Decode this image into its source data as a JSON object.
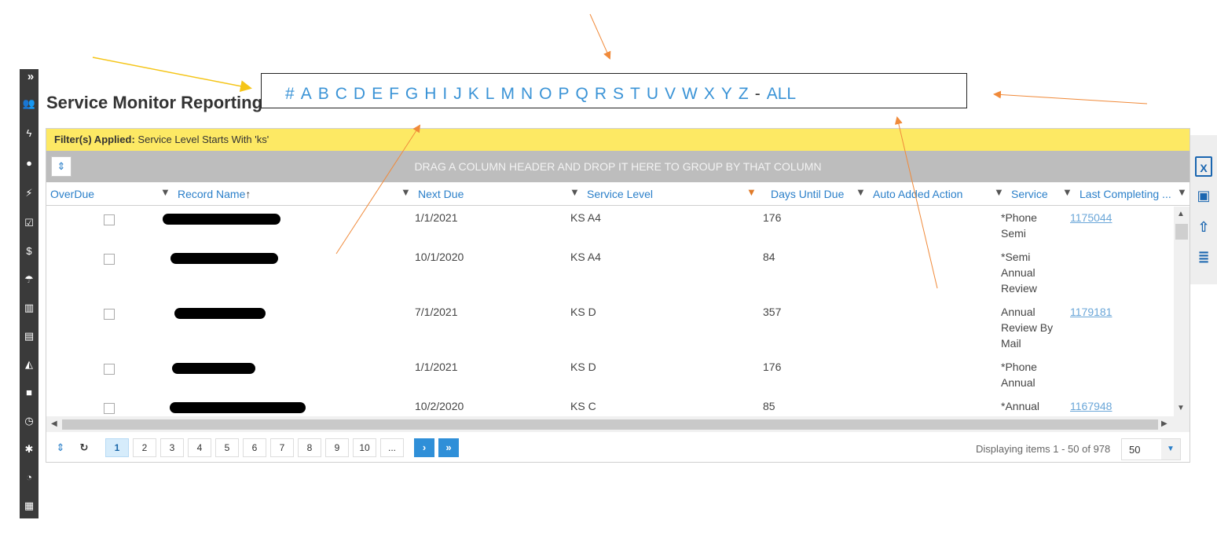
{
  "page": {
    "title": "Service Monitor Reporting"
  },
  "nav": {
    "expand_glyph": "»"
  },
  "alpha_filter": {
    "letters": [
      "#",
      "A",
      "B",
      "C",
      "D",
      "E",
      "F",
      "G",
      "H",
      "I",
      "J",
      "K",
      "L",
      "M",
      "N",
      "O",
      "P",
      "Q",
      "R",
      "S",
      "T",
      "U",
      "V",
      "W",
      "X",
      "Y",
      "Z"
    ],
    "separator": "-",
    "all_label": "ALL"
  },
  "filter_bar": {
    "label": "Filter(s) Applied:",
    "text": "Service Level Starts With 'ks'"
  },
  "group_bar": {
    "text": "DRAG A COLUMN HEADER AND DROP IT HERE TO GROUP BY THAT COLUMN"
  },
  "columns": {
    "overdue": "OverDue",
    "record_name": "Record Name",
    "record_name_sort": "↑",
    "next_due": "Next Due",
    "service_level": "Service Level",
    "days_until_due": "Days Until Due",
    "auto_added_action": "Auto Added Action",
    "service": "Service",
    "last_completing": "Last Completing ..."
  },
  "rows": [
    {
      "next_due": "1/1/2021",
      "service_level": "KS A4",
      "days": "176",
      "service": [
        "*Phone",
        "Semi"
      ],
      "last": "1175044"
    },
    {
      "next_due": "10/1/2020",
      "service_level": "KS A4",
      "days": "84",
      "service": [
        "*Semi",
        "Annual",
        "Review"
      ],
      "last": ""
    },
    {
      "next_due": "7/1/2021",
      "service_level": "KS D",
      "days": "357",
      "service": [
        "Annual",
        "Review By",
        "Mail"
      ],
      "last": "1179181"
    },
    {
      "next_due": "1/1/2021",
      "service_level": "KS D",
      "days": "176",
      "service": [
        "*Phone",
        "Annual"
      ],
      "last": ""
    },
    {
      "next_due": "10/2/2020",
      "service_level": "KS C",
      "days": "85",
      "service": [
        "*Annual"
      ],
      "last": "1167948"
    }
  ],
  "pager": {
    "pages": [
      "1",
      "2",
      "3",
      "4",
      "5",
      "6",
      "7",
      "8",
      "9",
      "10",
      "..."
    ],
    "current": "1",
    "next": "›",
    "last": "»",
    "info": "Displaying items 1 - 50 of 978",
    "page_size": "50"
  },
  "icons": {
    "expand": "⇕",
    "refresh": "↻",
    "excel": "X",
    "save": "▣",
    "upload": "⇧",
    "report": "≣"
  },
  "colors": {
    "accent": "#2a7fc9",
    "filter_bg": "#fde964",
    "annotation_orange": "#f08a3a",
    "annotation_yellow": "#f5c518"
  }
}
